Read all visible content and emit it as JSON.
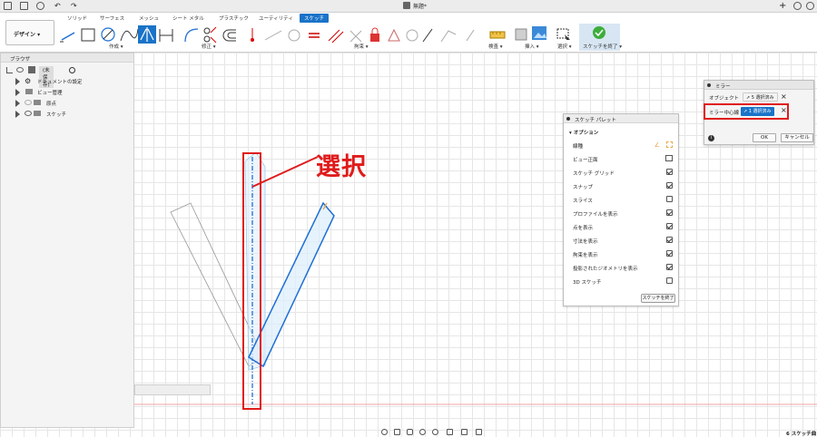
{
  "window": {
    "title": "無題*"
  },
  "tabs": [
    "ソリッド",
    "サーフェス",
    "メッシュ",
    "シート メタル",
    "プラスチック",
    "ユーティリティ",
    "スケッチ"
  ],
  "active_tab": "スケッチ",
  "workspace_button": "デザイン ▾",
  "ribbon_groups": {
    "create": "作成 ▾",
    "modify": "修正 ▾",
    "constraints": "拘束 ▾",
    "inspect": "検査 ▾",
    "insert": "挿入 ▾",
    "select": "選択 ▾",
    "finish": "スケッチを終了 ▾"
  },
  "browser": {
    "title": "ブラウザ",
    "root": "(未保存)",
    "items": [
      "ドキュメントの設定",
      "ビュー管理",
      "原点",
      "スケッチ"
    ]
  },
  "annotation": {
    "text": "選択",
    "color": "#e01b1b"
  },
  "palette": {
    "title": "スケッチ パレット",
    "section": "オプション",
    "rows": [
      {
        "label": "線種",
        "type": "icons"
      },
      {
        "label": "ビュー正面",
        "type": "icon"
      },
      {
        "label": "スケッチ グリッド",
        "checked": true
      },
      {
        "label": "スナップ",
        "checked": true
      },
      {
        "label": "スライス",
        "checked": false
      },
      {
        "label": "プロファイルを表示",
        "checked": true
      },
      {
        "label": "点を表示",
        "checked": true
      },
      {
        "label": "寸法を表示",
        "checked": true
      },
      {
        "label": "拘束を表示",
        "checked": true
      },
      {
        "label": "投影されたジオメトリを表示",
        "checked": true
      },
      {
        "label": "3D スケッチ",
        "checked": false
      }
    ],
    "finish_button": "スケッチを終了"
  },
  "mirror": {
    "title": "ミラー",
    "objects_label": "オブジェクト",
    "objects_value": "5 選択済み",
    "line_label": "ミラー中心線",
    "line_value": "1 選択済み",
    "ok": "OK",
    "cancel": "キャンセル"
  },
  "status": "6 スケッチ曲",
  "colors": {
    "accent": "#1a73c8",
    "sketch_blue": "#1f6fd6",
    "red": "#e01b1b"
  }
}
